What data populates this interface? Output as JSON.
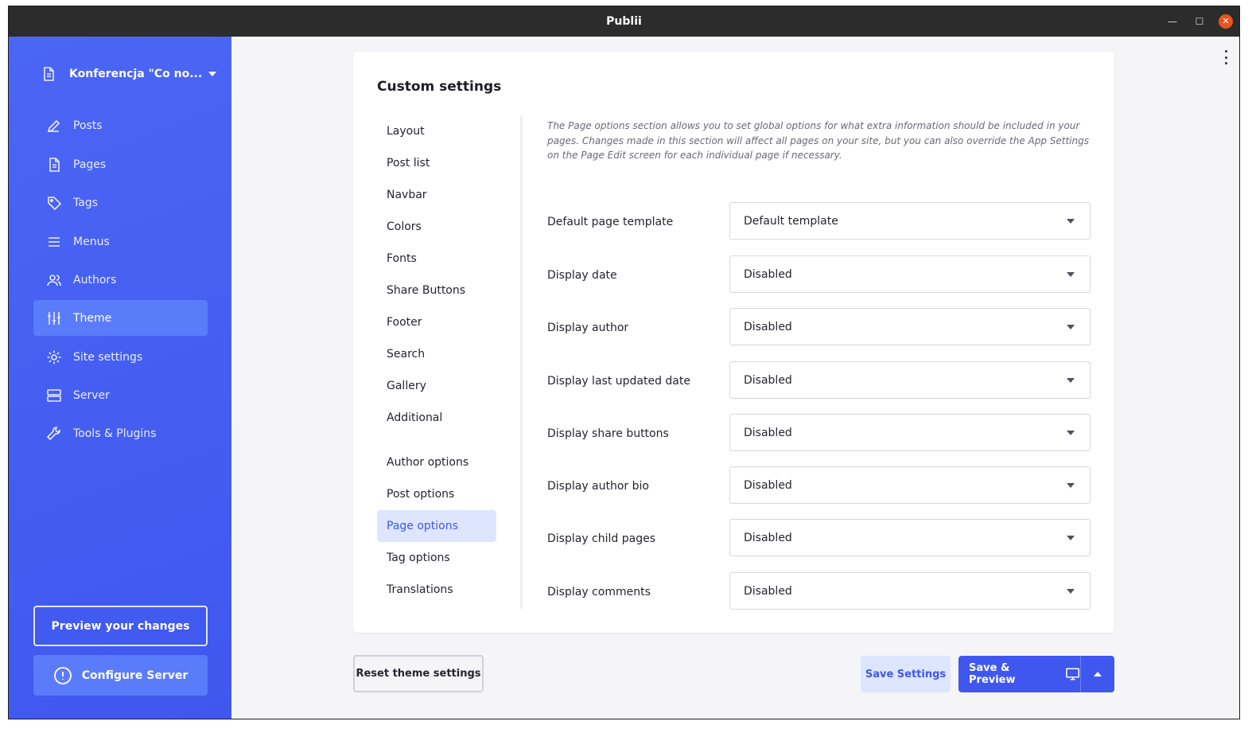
{
  "window": {
    "title": "Publii",
    "min_glyph": "—",
    "max_glyph": "☐",
    "close_glyph": "✕"
  },
  "sidebar": {
    "site_name": "Konferencja \"Co no...",
    "items": [
      {
        "label": "Posts",
        "icon": "pen-icon"
      },
      {
        "label": "Pages",
        "icon": "page-icon"
      },
      {
        "label": "Tags",
        "icon": "tag-icon"
      },
      {
        "label": "Menus",
        "icon": "menu-icon"
      },
      {
        "label": "Authors",
        "icon": "users-icon"
      },
      {
        "label": "Theme",
        "icon": "sliders-icon",
        "active": true
      },
      {
        "label": "Site settings",
        "icon": "gear-icon"
      },
      {
        "label": "Server",
        "icon": "server-icon"
      },
      {
        "label": "Tools & Plugins",
        "icon": "wrench-icon"
      }
    ],
    "preview_label": "Preview your changes",
    "configure_label": "Configure Server"
  },
  "custom_settings": {
    "title": "Custom settings",
    "nav": [
      "Layout",
      "Post list",
      "Navbar",
      "Colors",
      "Fonts",
      "Share Buttons",
      "Footer",
      "Search",
      "Gallery",
      "Additional",
      "Author options",
      "Post options",
      "Page options",
      "Tag options",
      "Translations"
    ],
    "active_nav": "Page options",
    "description": "The Page options section allows you to set global options for what extra information should be included in your pages. Changes made in this section will affect all pages on your site, but you can also override the App Settings on the Page Edit screen for each individual page if necessary.",
    "fields": [
      {
        "label": "Default page template",
        "value": "Default template"
      },
      {
        "label": "Display date",
        "value": "Disabled"
      },
      {
        "label": "Display author",
        "value": "Disabled"
      },
      {
        "label": "Display last updated date",
        "value": "Disabled"
      },
      {
        "label": "Display share buttons",
        "value": "Disabled"
      },
      {
        "label": "Display author bio",
        "value": "Disabled"
      },
      {
        "label": "Display child pages",
        "value": "Disabled"
      },
      {
        "label": "Display comments",
        "value": "Disabled"
      }
    ]
  },
  "footer": {
    "reset_label": "Reset theme settings",
    "save_label": "Save Settings",
    "save_preview_label": "Save & Preview"
  },
  "colors": {
    "accent": "#3f57ee",
    "sidebar": "#4b66f5",
    "active_bg": "#dee6ff"
  }
}
